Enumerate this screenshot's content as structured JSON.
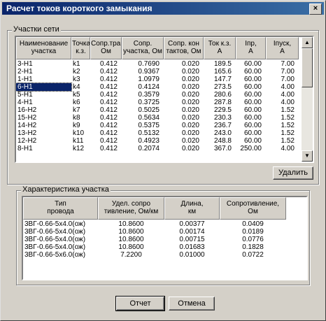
{
  "window": {
    "title": "Расчет токов короткого замыкания",
    "close_glyph": "×"
  },
  "sections": {
    "top": {
      "label": "Участки сети"
    },
    "bottom": {
      "label": "Характеристика участка"
    }
  },
  "top_table": {
    "headers": [
      [
        "Наименование",
        "участка"
      ],
      [
        "Точка",
        "к.з."
      ],
      [
        "Сопр.тран",
        "Ом"
      ],
      [
        "Сопр.",
        "участка, Ом"
      ],
      [
        "Сопр. кон",
        "тактов, Ом"
      ],
      [
        "Ток к.з.",
        "A"
      ],
      [
        "Iпр,",
        "A"
      ],
      [
        "Iпуск,",
        "A"
      ]
    ],
    "rows": [
      [
        "3-H1",
        "k1",
        "0.412",
        "0.7690",
        "0.020",
        "189.5",
        "60.00",
        "7.00"
      ],
      [
        "2-H1",
        "k2",
        "0.412",
        "0.9367",
        "0.020",
        "165.6",
        "60.00",
        "7.00"
      ],
      [
        "1-H1",
        "k3",
        "0.412",
        "1.0979",
        "0.020",
        "147.7",
        "60.00",
        "7.00"
      ],
      [
        "6-H1",
        "k4",
        "0.412",
        "0.4124",
        "0.020",
        "273.5",
        "60.00",
        "4.00"
      ],
      [
        "5-H1",
        "k5",
        "0.412",
        "0.3579",
        "0.020",
        "280.6",
        "60.00",
        "4.00"
      ],
      [
        "4-H1",
        "k6",
        "0.412",
        "0.3725",
        "0.020",
        "287.8",
        "60.00",
        "4.00"
      ],
      [
        "16-H2",
        "k7",
        "0.412",
        "0.5025",
        "0.020",
        "229.5",
        "60.00",
        "1.52"
      ],
      [
        "15-H2",
        "k8",
        "0.412",
        "0.5634",
        "0.020",
        "230.3",
        "60.00",
        "1.52"
      ],
      [
        "14-H2",
        "k9",
        "0.412",
        "0.5375",
        "0.020",
        "236.7",
        "60.00",
        "1.52"
      ],
      [
        "13-H2",
        "k10",
        "0.412",
        "0.5132",
        "0.020",
        "243.0",
        "60.00",
        "1.52"
      ],
      [
        "12-H2",
        "k11",
        "0.412",
        "0.4923",
        "0.020",
        "248.8",
        "60.00",
        "1.52"
      ],
      [
        "8-H1",
        "k12",
        "0.412",
        "0.2074",
        "0.020",
        "367.0",
        "250.00",
        "4.00"
      ]
    ],
    "selected_row": 3
  },
  "delete_button": {
    "label": "Удалить"
  },
  "bottom_table": {
    "headers": [
      [
        "Тип",
        "провода"
      ],
      [
        "Удел. сопро",
        "тивление, Ом/км"
      ],
      [
        "Длина,",
        "км"
      ],
      [
        "Сопротивление,",
        "Ом"
      ]
    ],
    "rows": [
      [
        "3ВГ-0.66-5х4.0(ож)",
        "10.8600",
        "0.00377",
        "0.0409"
      ],
      [
        "3ВГ-0.66-5х4.0(ож)",
        "10.8600",
        "0.00174",
        "0.0189"
      ],
      [
        "3ВГ-0.66-5х4.0(ож)",
        "10.8600",
        "0.00715",
        "0.0776"
      ],
      [
        "3ВГ-0.66-5х4.0(ож)",
        "10.8600",
        "0.01683",
        "0.1828"
      ],
      [
        "3ВГ-0.66-5х6.0(ож)",
        "7.2200",
        "0.01000",
        "0.0722"
      ]
    ]
  },
  "footer": {
    "report_label": "Отчет",
    "cancel_label": "Отмена"
  },
  "icons": {
    "scroll_up": "▲",
    "scroll_down": "▼"
  },
  "colors": {
    "title_bar": "#0a246a",
    "face": "#d4d0c8",
    "selection": "#0a246a"
  }
}
